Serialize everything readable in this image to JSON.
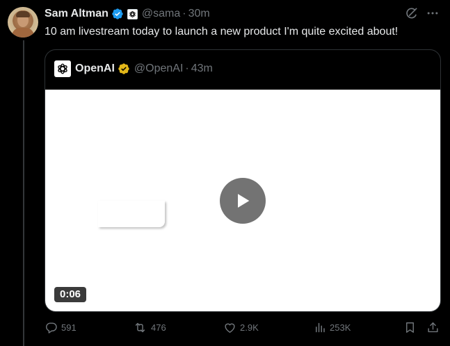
{
  "tweet": {
    "author_name": "Sam Altman",
    "handle": "@sama",
    "separator": "·",
    "time": "30m",
    "text": "10 am livestream today to launch a new product I'm quite excited about!"
  },
  "quoted": {
    "author_name": "OpenAI",
    "handle": "@OpenAI",
    "separator": "·",
    "time": "43m",
    "video_duration": "0:06"
  },
  "metrics": {
    "replies": "591",
    "reposts": "476",
    "likes": "2.9K",
    "views": "253K"
  },
  "colors": {
    "background": "#000000",
    "text": "#e7e9ea",
    "muted": "#71767b",
    "verified_blue": "#1d9bf0",
    "verified_gold": "#e2b719",
    "border": "#2f3336"
  },
  "icons": {
    "verified": "verified-badge-icon",
    "grok": "grok-icon",
    "more": "more-icon",
    "reply": "reply-icon",
    "repost": "repost-icon",
    "like": "heart-icon",
    "views": "views-icon",
    "bookmark": "bookmark-icon",
    "share": "share-icon",
    "play": "play-icon"
  }
}
